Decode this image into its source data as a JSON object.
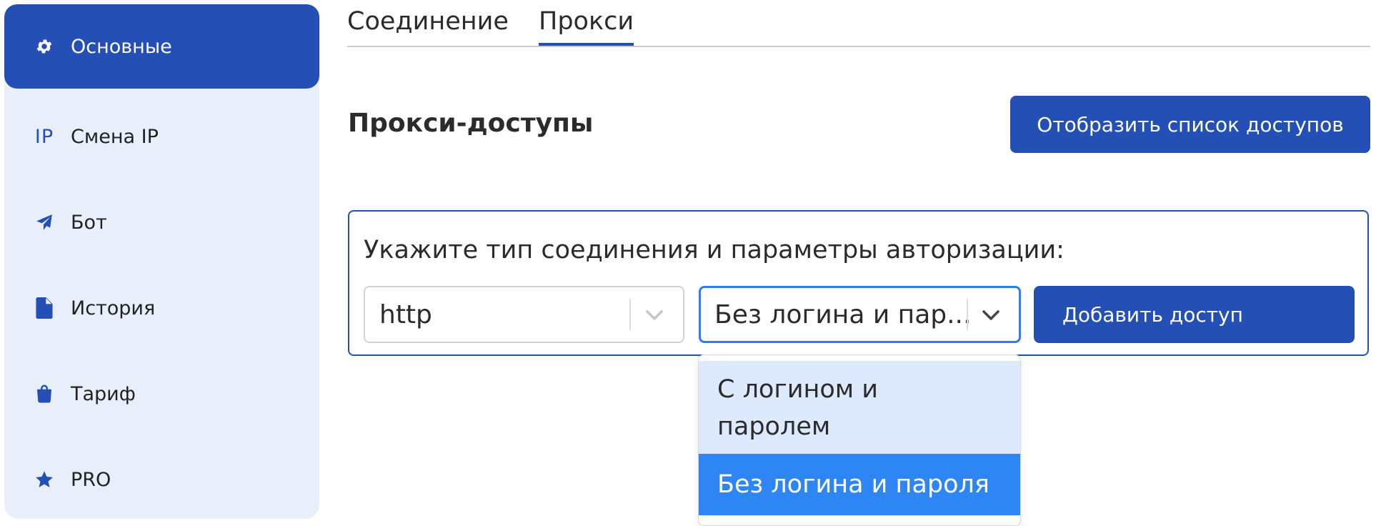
{
  "sidebar": {
    "items": [
      {
        "label": "Основные",
        "icon": "gear-icon"
      },
      {
        "label": "Смена IP",
        "icon": "ip-icon",
        "icon_text": "IP"
      },
      {
        "label": "Бот",
        "icon": "paper-plane-icon"
      },
      {
        "label": "История",
        "icon": "document-icon"
      },
      {
        "label": "Тариф",
        "icon": "shopping-bag-icon"
      },
      {
        "label": "PRO",
        "icon": "star-icon"
      }
    ]
  },
  "tabs": [
    {
      "label": "Соединение"
    },
    {
      "label": "Прокси"
    }
  ],
  "main": {
    "section_title": "Прокси-доступы",
    "show_list_button": "Отобразить список доступов",
    "form": {
      "label": "Укажите тип соединения и параметры авторизации:",
      "protocol_value": "http",
      "auth_value": "Без логина и пар...",
      "add_button": "Добавить доступ"
    }
  },
  "dropdown": {
    "options": [
      {
        "label_line1": "С логином и",
        "label_line2": "паролем"
      },
      {
        "label": "Без логина и пароля"
      }
    ]
  },
  "colors": {
    "accent": "#2450b5",
    "sidebar_bg": "#e8effb",
    "focus": "#2e7cf6",
    "option_selected": "#2e86f5",
    "option_hover": "#dde9fc"
  }
}
